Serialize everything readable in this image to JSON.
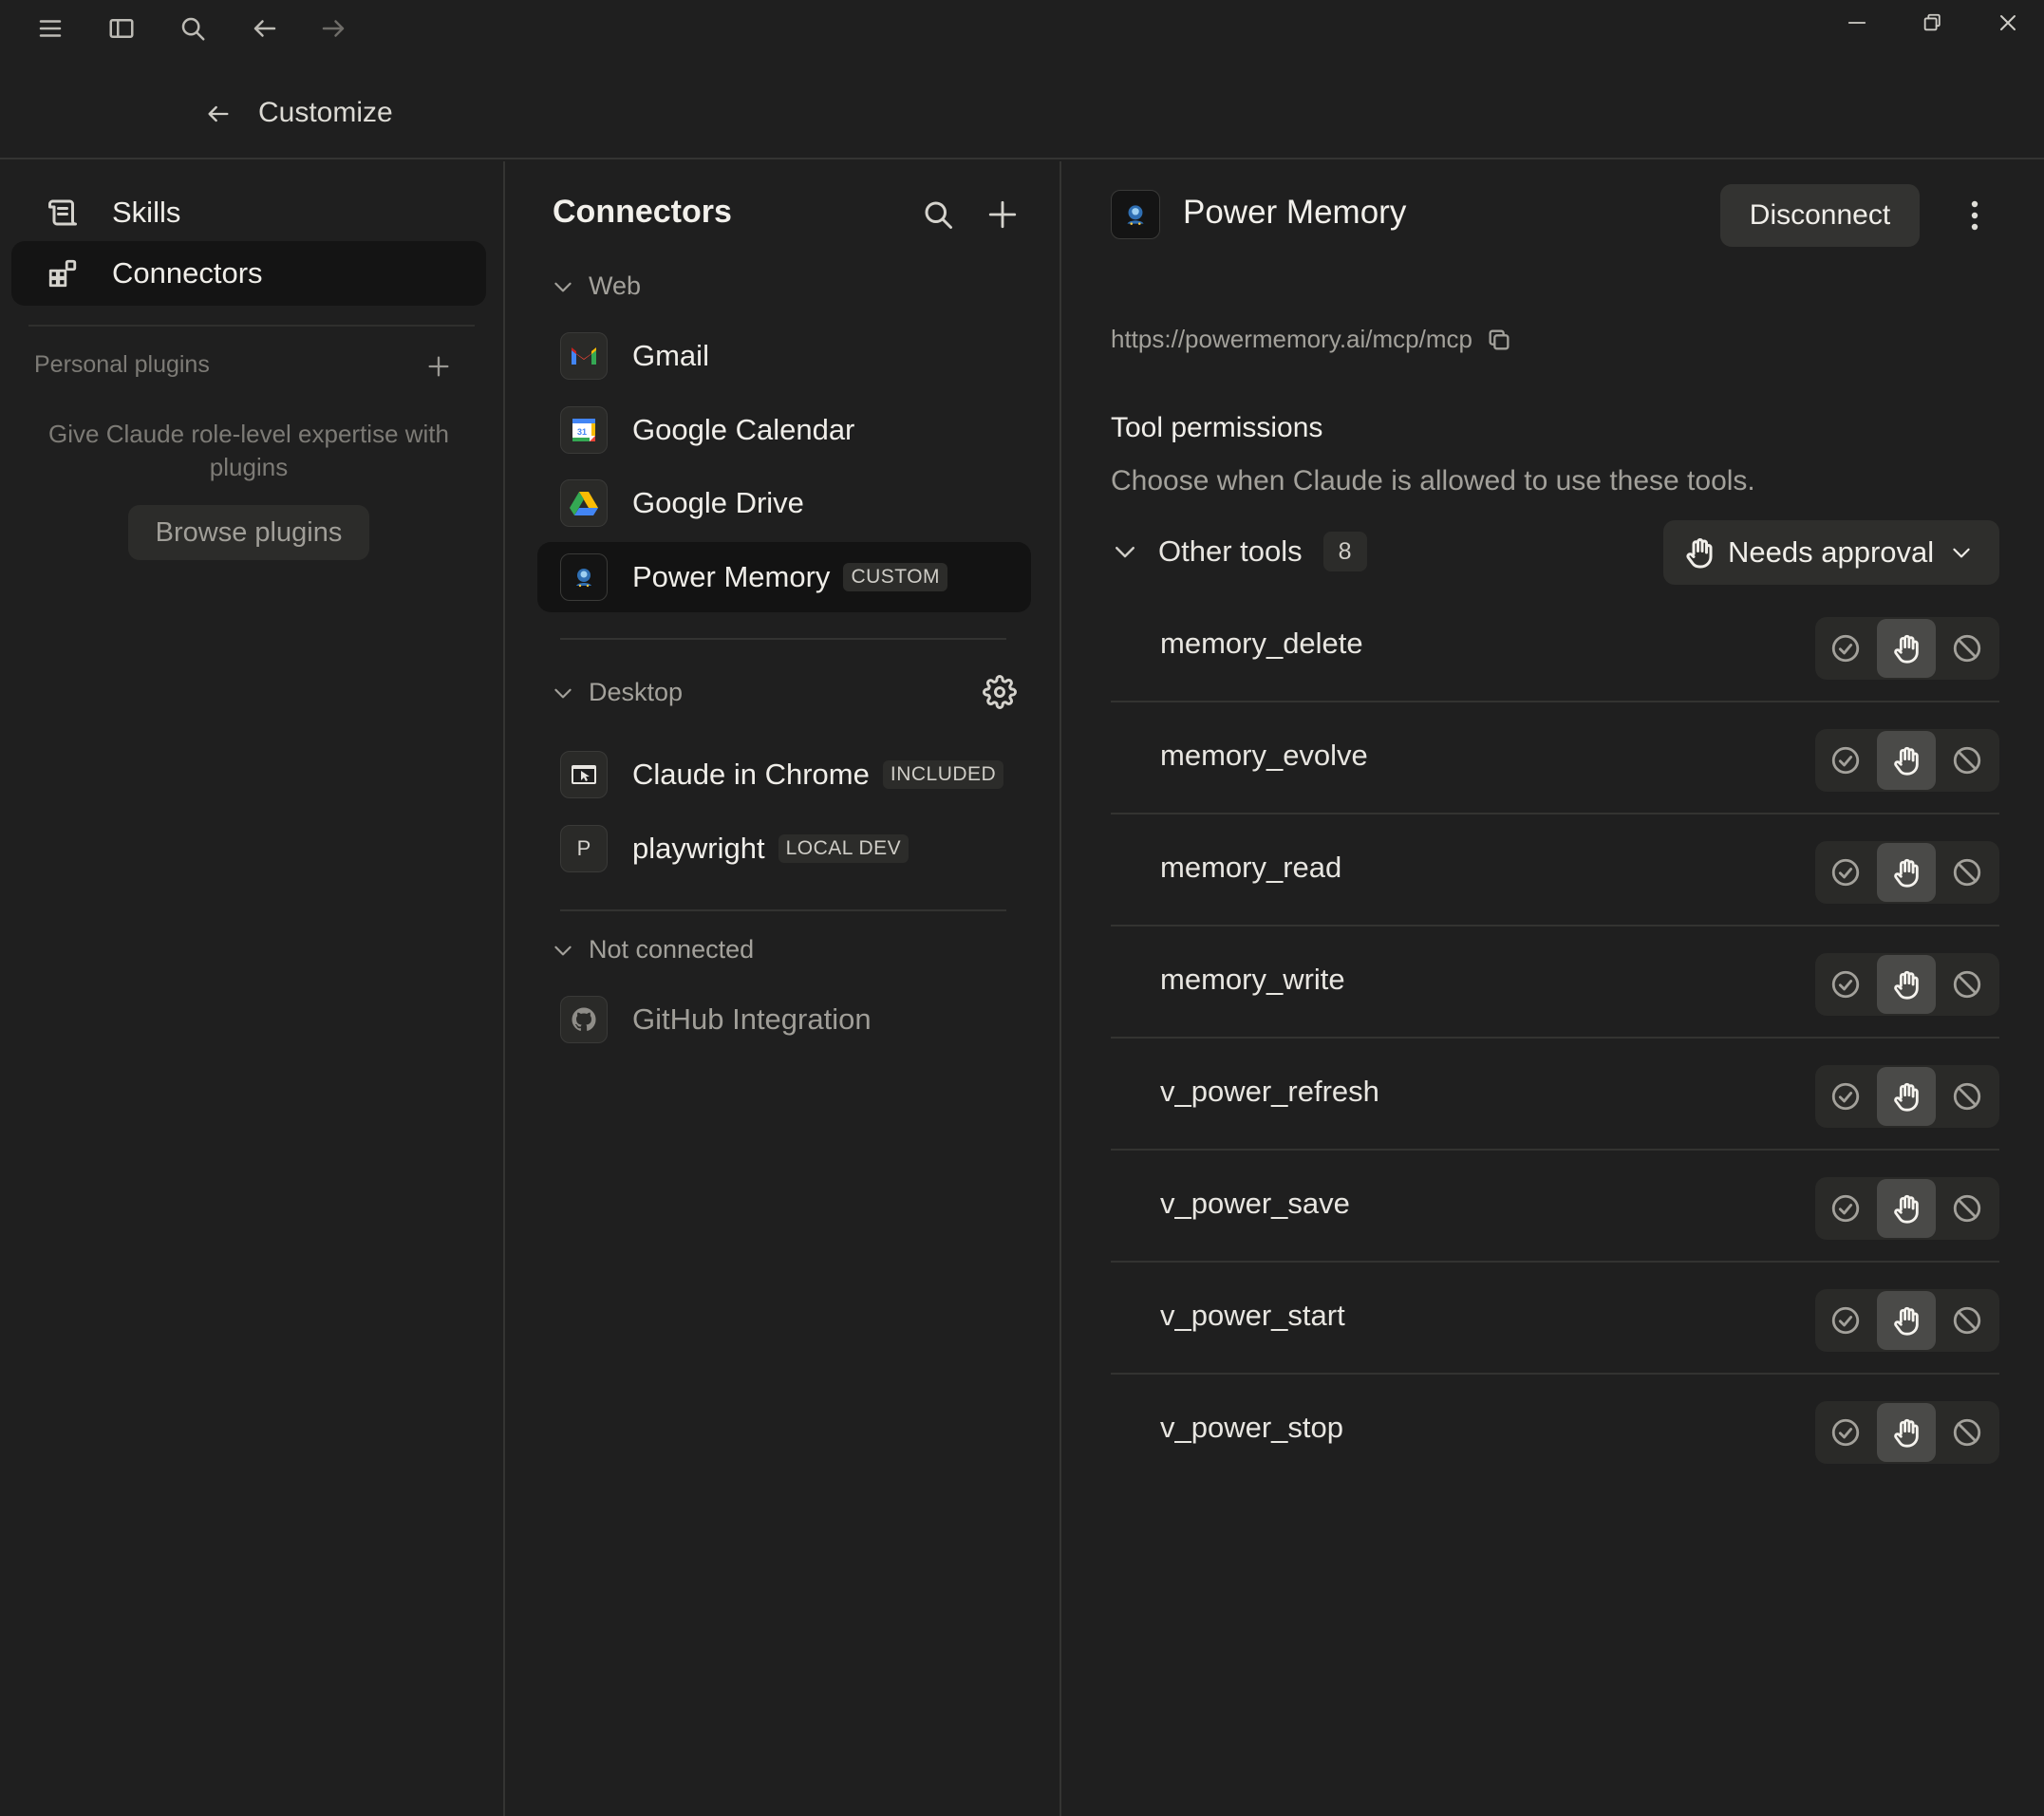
{
  "header": {
    "title": "Customize"
  },
  "sidebar": {
    "items": [
      {
        "label": "Skills",
        "icon": "scroll-icon"
      },
      {
        "label": "Connectors",
        "icon": "connectors-icon"
      }
    ],
    "personal_plugins_label": "Personal plugins",
    "hint": "Give Claude role-level expertise with plugins",
    "browse_label": "Browse plugins"
  },
  "connectors": {
    "title": "Connectors",
    "sections": {
      "web": "Web",
      "desktop": "Desktop",
      "not_connected": "Not connected"
    },
    "web": [
      {
        "name": "Gmail",
        "badge": ""
      },
      {
        "name": "Google Calendar",
        "badge": ""
      },
      {
        "name": "Google Drive",
        "badge": ""
      },
      {
        "name": "Power Memory",
        "badge": "CUSTOM"
      }
    ],
    "desktop": [
      {
        "name": "Claude in Chrome",
        "badge": "INCLUDED"
      },
      {
        "name": "playwright",
        "badge": "LOCAL DEV",
        "icon_letter": "P"
      }
    ],
    "not_connected": [
      {
        "name": "GitHub Integration",
        "badge": ""
      }
    ]
  },
  "detail": {
    "title": "Power Memory",
    "disconnect_label": "Disconnect",
    "url": "https://powermemory.ai/mcp/mcp",
    "tool_permissions_title": "Tool permissions",
    "tool_permissions_subtitle": "Choose when Claude is allowed to use these tools.",
    "group_name": "Other tools",
    "group_count": "8",
    "group_mode": "Needs approval",
    "tools": [
      {
        "name": "memory_delete",
        "mode": "needs-approval"
      },
      {
        "name": "memory_evolve",
        "mode": "needs-approval"
      },
      {
        "name": "memory_read",
        "mode": "needs-approval"
      },
      {
        "name": "memory_write",
        "mode": "needs-approval"
      },
      {
        "name": "v_power_refresh",
        "mode": "needs-approval"
      },
      {
        "name": "v_power_save",
        "mode": "needs-approval"
      },
      {
        "name": "v_power_start",
        "mode": "needs-approval"
      },
      {
        "name": "v_power_stop",
        "mode": "needs-approval"
      }
    ]
  },
  "colors": {
    "background": "#1f1f1f",
    "active_item": "#141414",
    "selected_option": "#4a4a48"
  }
}
